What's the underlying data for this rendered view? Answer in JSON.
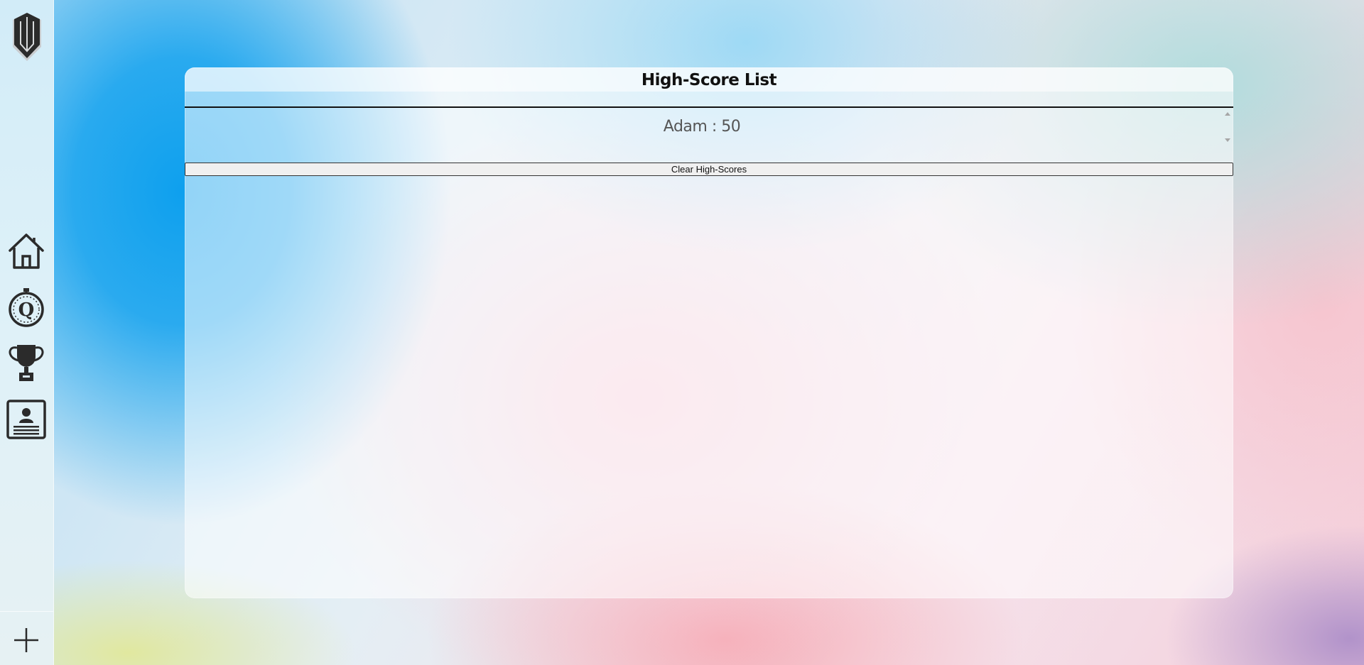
{
  "sidebar": {
    "logo": "shield-logo",
    "nav": [
      {
        "name": "home",
        "icon": "home-icon"
      },
      {
        "name": "quiz",
        "icon": "quiz-timer-icon"
      },
      {
        "name": "high-scores",
        "icon": "trophy-icon"
      },
      {
        "name": "profile",
        "icon": "contact-card-icon"
      }
    ],
    "add_icon": "plus-icon"
  },
  "panel": {
    "title": "High-Score List",
    "scores": [
      "Adam : 50"
    ],
    "clear_label": "Clear High-Scores"
  },
  "colors": {
    "icon": "#2b2b2b",
    "panel_bg": "rgba(255,255,255,0.55)",
    "accent_blue": "#0ea0ee"
  }
}
